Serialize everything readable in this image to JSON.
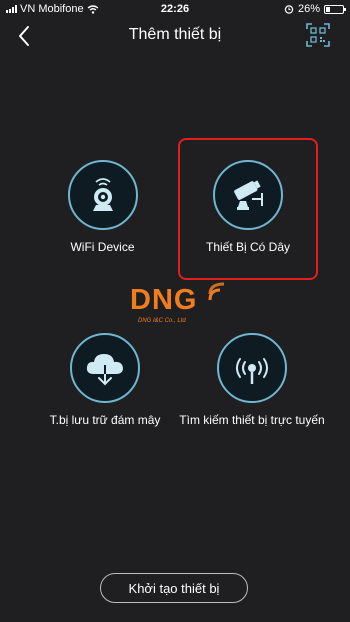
{
  "status_bar": {
    "carrier": "VN Mobifone",
    "time": "22:26",
    "battery_percent": "26%",
    "battery_level": 0.26,
    "icons": [
      "signal-icon",
      "wifi-icon",
      "alarm-icon",
      "battery-icon"
    ]
  },
  "nav": {
    "title": "Thêm thiết bị",
    "back_icon": "chevron-left-icon",
    "qr_icon": "qr-scan-icon"
  },
  "options": [
    {
      "label": "WiFi Device",
      "icon": "webcam-icon",
      "highlighted": false
    },
    {
      "label": "Thiết Bị Có Dây",
      "icon": "cctv-camera-icon",
      "highlighted": true
    },
    {
      "label": "T.bị lưu trữ đám mây",
      "icon": "cloud-download-icon",
      "highlighted": false
    },
    {
      "label": "Tìm kiếm thiết bị trực tuyến",
      "icon": "broadcast-icon",
      "highlighted": false
    }
  ],
  "watermark": {
    "logo_text": "DNG",
    "subtitle": "DNG I&C Co., Ltd"
  },
  "bottom_button": {
    "label": "Khởi tạo thiết bị"
  },
  "colors": {
    "background": "#1f1f21",
    "icon_ring": "#6fb6cf",
    "highlight": "#e0201b",
    "watermark": "#f07d1e"
  }
}
